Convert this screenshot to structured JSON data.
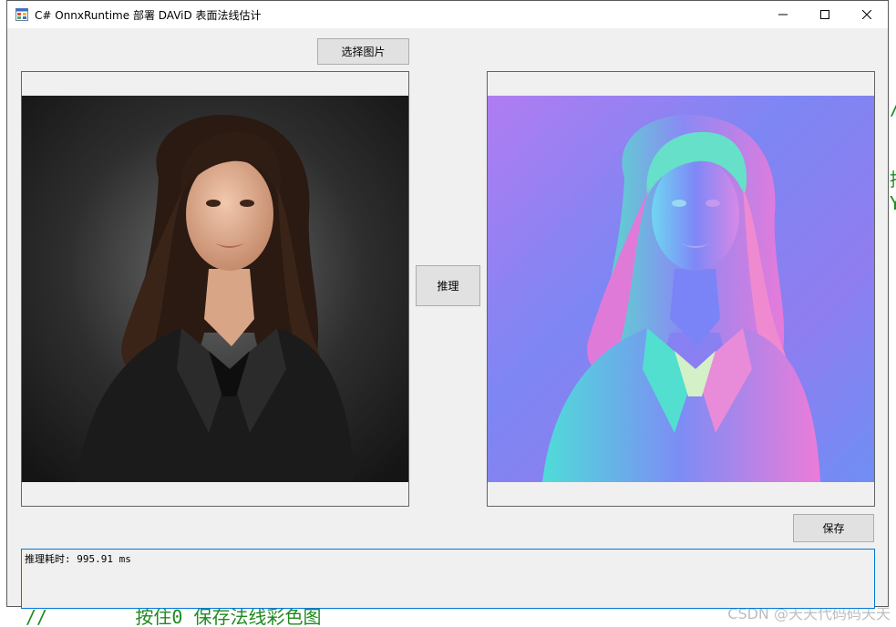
{
  "window": {
    "title": "C# OnnxRuntime 部署 DAViD  表面法线估计",
    "app_icon": "windows-form-icon",
    "controls": {
      "minimize_icon": "minimize-icon",
      "maximize_icon": "maximize-icon",
      "close_icon": "close-icon"
    }
  },
  "buttons": {
    "select_image": "选择图片",
    "infer": "推理",
    "save": "保存"
  },
  "images": {
    "input": "portrait-photo",
    "output": "surface-normal-map"
  },
  "output": {
    "text": "推理耗时: 995.91 ms"
  },
  "background": {
    "bottom_code": "//        按住0 保存法线彩色图",
    "right_code_1": "/",
    "right_code_2": "持",
    "right_code_3": "Y"
  },
  "watermark": "CSDN @天天代码码天天",
  "colors": {
    "window_bg": "#f0f0f0",
    "focus_border": "#0078d7",
    "button_bg": "#e1e1e1"
  }
}
